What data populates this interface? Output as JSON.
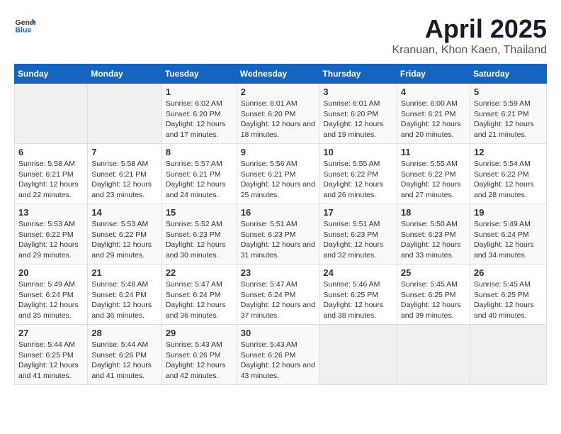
{
  "header": {
    "logo_general": "General",
    "logo_blue": "Blue",
    "main_title": "April 2025",
    "subtitle": "Kranuan, Khon Kaen, Thailand"
  },
  "calendar": {
    "days_of_week": [
      "Sunday",
      "Monday",
      "Tuesday",
      "Wednesday",
      "Thursday",
      "Friday",
      "Saturday"
    ],
    "weeks": [
      [
        {
          "day": "",
          "sunrise": "",
          "sunset": "",
          "daylight": "",
          "empty": true
        },
        {
          "day": "",
          "sunrise": "",
          "sunset": "",
          "daylight": "",
          "empty": true
        },
        {
          "day": "1",
          "sunrise": "Sunrise: 6:02 AM",
          "sunset": "Sunset: 6:20 PM",
          "daylight": "Daylight: 12 hours and 17 minutes.",
          "empty": false
        },
        {
          "day": "2",
          "sunrise": "Sunrise: 6:01 AM",
          "sunset": "Sunset: 6:20 PM",
          "daylight": "Daylight: 12 hours and 18 minutes.",
          "empty": false
        },
        {
          "day": "3",
          "sunrise": "Sunrise: 6:01 AM",
          "sunset": "Sunset: 6:20 PM",
          "daylight": "Daylight: 12 hours and 19 minutes.",
          "empty": false
        },
        {
          "day": "4",
          "sunrise": "Sunrise: 6:00 AM",
          "sunset": "Sunset: 6:21 PM",
          "daylight": "Daylight: 12 hours and 20 minutes.",
          "empty": false
        },
        {
          "day": "5",
          "sunrise": "Sunrise: 5:59 AM",
          "sunset": "Sunset: 6:21 PM",
          "daylight": "Daylight: 12 hours and 21 minutes.",
          "empty": false
        }
      ],
      [
        {
          "day": "6",
          "sunrise": "Sunrise: 5:58 AM",
          "sunset": "Sunset: 6:21 PM",
          "daylight": "Daylight: 12 hours and 22 minutes.",
          "empty": false
        },
        {
          "day": "7",
          "sunrise": "Sunrise: 5:58 AM",
          "sunset": "Sunset: 6:21 PM",
          "daylight": "Daylight: 12 hours and 23 minutes.",
          "empty": false
        },
        {
          "day": "8",
          "sunrise": "Sunrise: 5:57 AM",
          "sunset": "Sunset: 6:21 PM",
          "daylight": "Daylight: 12 hours and 24 minutes.",
          "empty": false
        },
        {
          "day": "9",
          "sunrise": "Sunrise: 5:56 AM",
          "sunset": "Sunset: 6:21 PM",
          "daylight": "Daylight: 12 hours and 25 minutes.",
          "empty": false
        },
        {
          "day": "10",
          "sunrise": "Sunrise: 5:55 AM",
          "sunset": "Sunset: 6:22 PM",
          "daylight": "Daylight: 12 hours and 26 minutes.",
          "empty": false
        },
        {
          "day": "11",
          "sunrise": "Sunrise: 5:55 AM",
          "sunset": "Sunset: 6:22 PM",
          "daylight": "Daylight: 12 hours and 27 minutes.",
          "empty": false
        },
        {
          "day": "12",
          "sunrise": "Sunrise: 5:54 AM",
          "sunset": "Sunset: 6:22 PM",
          "daylight": "Daylight: 12 hours and 28 minutes.",
          "empty": false
        }
      ],
      [
        {
          "day": "13",
          "sunrise": "Sunrise: 5:53 AM",
          "sunset": "Sunset: 6:22 PM",
          "daylight": "Daylight: 12 hours and 29 minutes.",
          "empty": false
        },
        {
          "day": "14",
          "sunrise": "Sunrise: 5:53 AM",
          "sunset": "Sunset: 6:22 PM",
          "daylight": "Daylight: 12 hours and 29 minutes.",
          "empty": false
        },
        {
          "day": "15",
          "sunrise": "Sunrise: 5:52 AM",
          "sunset": "Sunset: 6:23 PM",
          "daylight": "Daylight: 12 hours and 30 minutes.",
          "empty": false
        },
        {
          "day": "16",
          "sunrise": "Sunrise: 5:51 AM",
          "sunset": "Sunset: 6:23 PM",
          "daylight": "Daylight: 12 hours and 31 minutes.",
          "empty": false
        },
        {
          "day": "17",
          "sunrise": "Sunrise: 5:51 AM",
          "sunset": "Sunset: 6:23 PM",
          "daylight": "Daylight: 12 hours and 32 minutes.",
          "empty": false
        },
        {
          "day": "18",
          "sunrise": "Sunrise: 5:50 AM",
          "sunset": "Sunset: 6:23 PM",
          "daylight": "Daylight: 12 hours and 33 minutes.",
          "empty": false
        },
        {
          "day": "19",
          "sunrise": "Sunrise: 5:49 AM",
          "sunset": "Sunset: 6:24 PM",
          "daylight": "Daylight: 12 hours and 34 minutes.",
          "empty": false
        }
      ],
      [
        {
          "day": "20",
          "sunrise": "Sunrise: 5:49 AM",
          "sunset": "Sunset: 6:24 PM",
          "daylight": "Daylight: 12 hours and 35 minutes.",
          "empty": false
        },
        {
          "day": "21",
          "sunrise": "Sunrise: 5:48 AM",
          "sunset": "Sunset: 6:24 PM",
          "daylight": "Daylight: 12 hours and 36 minutes.",
          "empty": false
        },
        {
          "day": "22",
          "sunrise": "Sunrise: 5:47 AM",
          "sunset": "Sunset: 6:24 PM",
          "daylight": "Daylight: 12 hours and 36 minutes.",
          "empty": false
        },
        {
          "day": "23",
          "sunrise": "Sunrise: 5:47 AM",
          "sunset": "Sunset: 6:24 PM",
          "daylight": "Daylight: 12 hours and 37 minutes.",
          "empty": false
        },
        {
          "day": "24",
          "sunrise": "Sunrise: 5:46 AM",
          "sunset": "Sunset: 6:25 PM",
          "daylight": "Daylight: 12 hours and 38 minutes.",
          "empty": false
        },
        {
          "day": "25",
          "sunrise": "Sunrise: 5:45 AM",
          "sunset": "Sunset: 6:25 PM",
          "daylight": "Daylight: 12 hours and 39 minutes.",
          "empty": false
        },
        {
          "day": "26",
          "sunrise": "Sunrise: 5:45 AM",
          "sunset": "Sunset: 6:25 PM",
          "daylight": "Daylight: 12 hours and 40 minutes.",
          "empty": false
        }
      ],
      [
        {
          "day": "27",
          "sunrise": "Sunrise: 5:44 AM",
          "sunset": "Sunset: 6:25 PM",
          "daylight": "Daylight: 12 hours and 41 minutes.",
          "empty": false
        },
        {
          "day": "28",
          "sunrise": "Sunrise: 5:44 AM",
          "sunset": "Sunset: 6:26 PM",
          "daylight": "Daylight: 12 hours and 41 minutes.",
          "empty": false
        },
        {
          "day": "29",
          "sunrise": "Sunrise: 5:43 AM",
          "sunset": "Sunset: 6:26 PM",
          "daylight": "Daylight: 12 hours and 42 minutes.",
          "empty": false
        },
        {
          "day": "30",
          "sunrise": "Sunrise: 5:43 AM",
          "sunset": "Sunset: 6:26 PM",
          "daylight": "Daylight: 12 hours and 43 minutes.",
          "empty": false
        },
        {
          "day": "",
          "sunrise": "",
          "sunset": "",
          "daylight": "",
          "empty": true
        },
        {
          "day": "",
          "sunrise": "",
          "sunset": "",
          "daylight": "",
          "empty": true
        },
        {
          "day": "",
          "sunrise": "",
          "sunset": "",
          "daylight": "",
          "empty": true
        }
      ]
    ]
  }
}
